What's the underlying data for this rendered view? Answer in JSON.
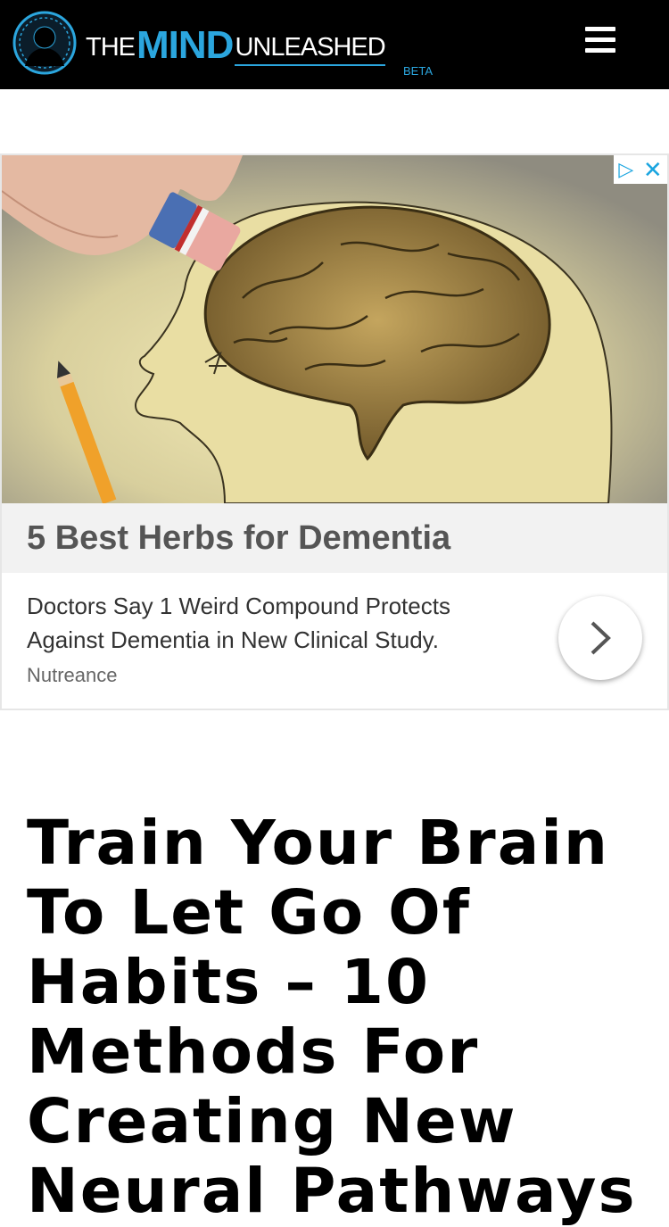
{
  "header": {
    "logo": {
      "the": "THE",
      "mind": "MIND",
      "unleashed": "UNLEASHED",
      "beta": "BETA"
    },
    "menu_icon": "hamburger-menu-icon",
    "colors": {
      "background": "#000000",
      "accent": "#2ba6de"
    }
  },
  "ad": {
    "choices_icon": "adchoices-icon",
    "close_icon": "close-icon",
    "image_subject": "eraser-erasing-drawn-brain-icon",
    "headline": "5 Best Herbs for Dementia",
    "description": "Doctors Say 1 Weird Compound Protects Against Dementia in New Clinical Study.",
    "source": "Nutreance",
    "arrow_icon": "chevron-right-icon"
  },
  "article": {
    "title": "Train Your Brain To Let Go Of Habits – 10 Methods For Creating New Neural Pathways"
  }
}
